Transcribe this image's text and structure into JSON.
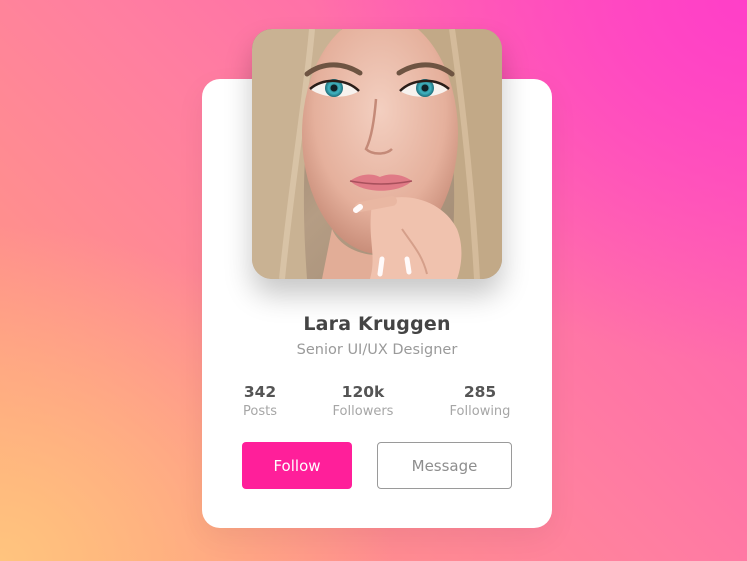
{
  "profile": {
    "avatar_alt": "Lara Kruggen",
    "name": "Lara Kruggen",
    "role": "Senior UI/UX Designer"
  },
  "stats": [
    {
      "value": "342",
      "label": "Posts"
    },
    {
      "value": "120k",
      "label": "Followers"
    },
    {
      "value": "285",
      "label": "Following"
    }
  ],
  "actions": {
    "follow_label": "Follow",
    "message_label": "Message"
  },
  "colors": {
    "accent": "#ff1f9a",
    "card": "#ffffff",
    "name_text": "#444444",
    "muted_text": "#9a9a9a"
  }
}
